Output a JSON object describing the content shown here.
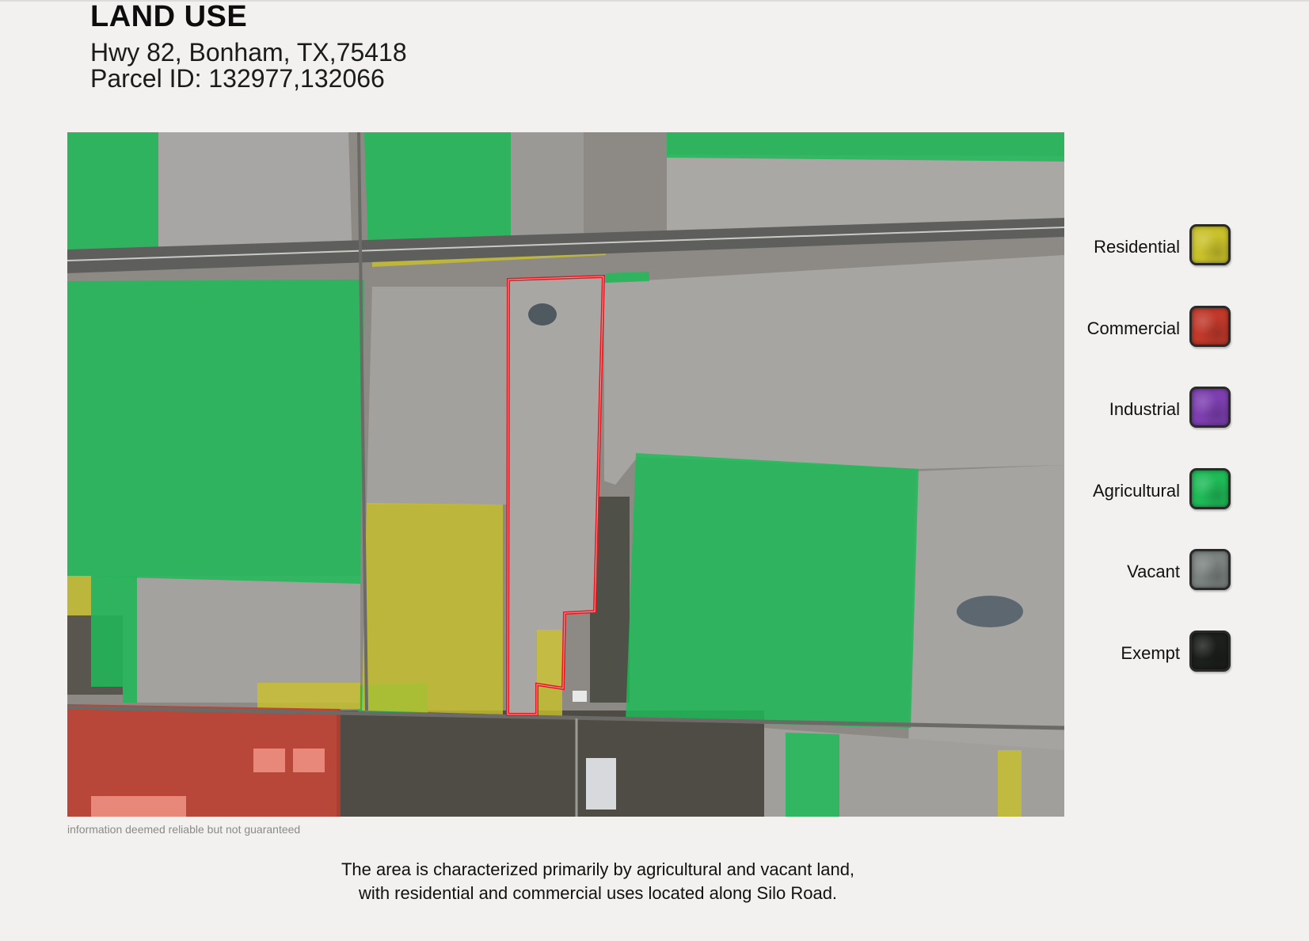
{
  "header": {
    "title": "LAND USE",
    "address": "Hwy 82, Bonham, TX,75418",
    "parcel": "Parcel ID: 132977,132066"
  },
  "map": {
    "disclaimer": "information deemed reliable but not guaranteed"
  },
  "legend": {
    "items": [
      {
        "label": "Residential",
        "color": "#c9c12a"
      },
      {
        "label": "Commercial",
        "color": "#c0392b"
      },
      {
        "label": "Industrial",
        "color": "#7d3fb0"
      },
      {
        "label": "Agricultural",
        "color": "#1fba57"
      },
      {
        "label": "Vacant",
        "color": "#7b8280"
      },
      {
        "label": "Exempt",
        "color": "#1c1f1b"
      }
    ]
  },
  "summary": {
    "line1": "The area is characterized primarily by agricultural and vacant land,",
    "line2": "with residential and commercial uses located along Silo Road."
  }
}
